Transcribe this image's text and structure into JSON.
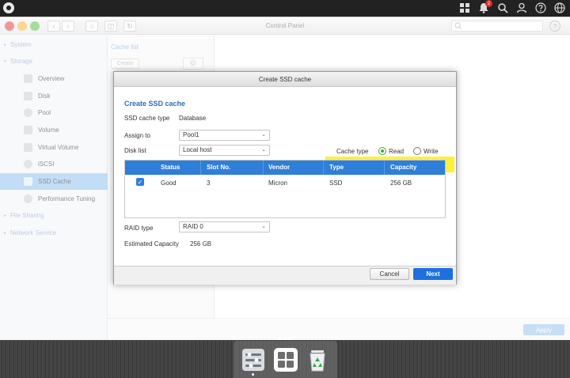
{
  "topbar": {
    "notification_count": "2",
    "icons": [
      "tasks-icon",
      "bell-icon",
      "search-icon",
      "user-icon",
      "help-icon",
      "globe-icon"
    ]
  },
  "window": {
    "title": "Control Panel",
    "help_label": "?"
  },
  "sidebar": {
    "groups": [
      {
        "label": "System"
      },
      {
        "label": "Storage"
      },
      {
        "label": "File Sharing"
      },
      {
        "label": "Network Service"
      }
    ],
    "items": [
      {
        "label": "Overview",
        "icon": "overview-icon"
      },
      {
        "label": "Disk",
        "icon": "disk-icon"
      },
      {
        "label": "Pool",
        "icon": "pool-icon"
      },
      {
        "label": "Volume",
        "icon": "volume-icon"
      },
      {
        "label": "Virtual Volume",
        "icon": "virtual-volume-icon"
      },
      {
        "label": "iSCSI",
        "icon": "iscsi-icon"
      },
      {
        "label": "SSD Cache",
        "icon": "ssd-cache-icon",
        "active": true
      },
      {
        "label": "Performance Tuning",
        "icon": "performance-icon"
      }
    ]
  },
  "cache_panel": {
    "title": "Cache list",
    "create_label": "Create"
  },
  "footer": {
    "apply_label": "Apply"
  },
  "dialog": {
    "title": "Create SSD cache",
    "heading": "Create SSD cache",
    "ssd_cache_type_label": "SSD cache type",
    "ssd_cache_type_value": "Database",
    "assign_to_label": "Assign to",
    "assign_to_value": "Pool1",
    "disk_list_label": "Disk list",
    "disk_list_value": "Local host",
    "cache_type_label": "Cache type",
    "cache_type_options": [
      {
        "label": "Read",
        "selected": true
      },
      {
        "label": "Write",
        "selected": false
      }
    ],
    "table": {
      "columns": [
        "Status",
        "Slot No.",
        "Vendor",
        "Type",
        "Capacity"
      ],
      "rows": [
        {
          "checked": true,
          "status": "Good",
          "slot": "3",
          "vendor": "Micron",
          "type": "SSD",
          "capacity": "256 GB"
        }
      ]
    },
    "raid_type_label": "RAID type",
    "raid_type_value": "RAID 0",
    "estimated_capacity_label": "Estimated Capacity",
    "estimated_capacity_value": "256 GB",
    "cancel_label": "Cancel",
    "next_label": "Next"
  },
  "dock": {
    "apps": [
      "control-panel-icon",
      "app-center-icon",
      "recycle-bin-icon"
    ]
  },
  "colors": {
    "accent": "#2f7ed8",
    "highlight": "#ffef3d",
    "sidebar_active": "#8ec3ef",
    "next_button": "#1f6fe0"
  }
}
